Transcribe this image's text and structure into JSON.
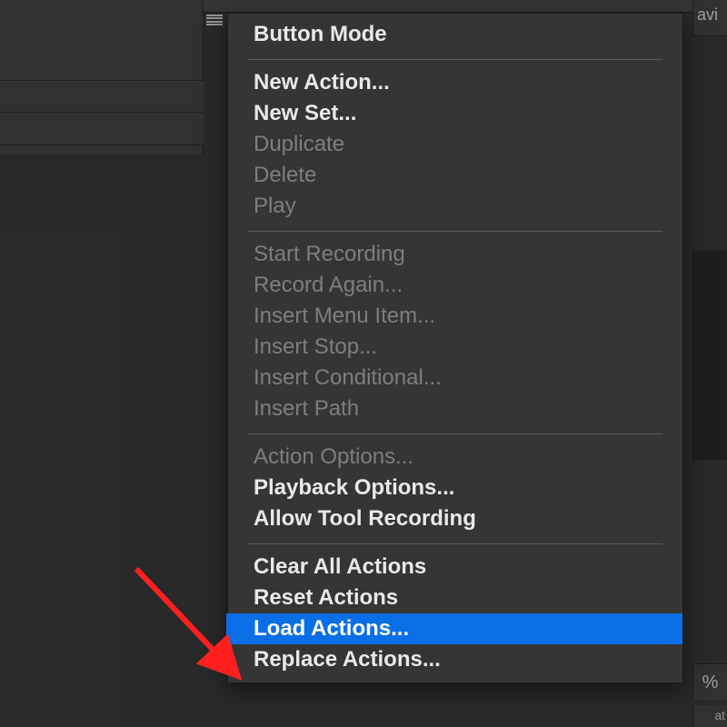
{
  "flyout_menu": {
    "groups": [
      [
        {
          "label": "Button Mode",
          "state": "bold"
        }
      ],
      [
        {
          "label": "New Action...",
          "state": "bold"
        },
        {
          "label": "New Set...",
          "state": "bold"
        },
        {
          "label": "Duplicate",
          "state": "disabled"
        },
        {
          "label": "Delete",
          "state": "disabled"
        },
        {
          "label": "Play",
          "state": "disabled"
        }
      ],
      [
        {
          "label": "Start Recording",
          "state": "disabled"
        },
        {
          "label": "Record Again...",
          "state": "disabled"
        },
        {
          "label": "Insert Menu Item...",
          "state": "disabled"
        },
        {
          "label": "Insert Stop...",
          "state": "disabled"
        },
        {
          "label": "Insert Conditional...",
          "state": "disabled"
        },
        {
          "label": "Insert Path",
          "state": "disabled"
        }
      ],
      [
        {
          "label": "Action Options...",
          "state": "disabled"
        },
        {
          "label": "Playback Options...",
          "state": "bold"
        },
        {
          "label": "Allow Tool Recording",
          "state": "bold"
        }
      ],
      [
        {
          "label": "Clear All Actions",
          "state": "bold"
        },
        {
          "label": "Reset Actions",
          "state": "bold"
        },
        {
          "label": "Load Actions...",
          "state": "highlight bold"
        },
        {
          "label": "Replace Actions...",
          "state": "bold"
        }
      ]
    ]
  },
  "top_right_tab_text": "avi",
  "right_pct_text": "%",
  "right_small_text": "at"
}
